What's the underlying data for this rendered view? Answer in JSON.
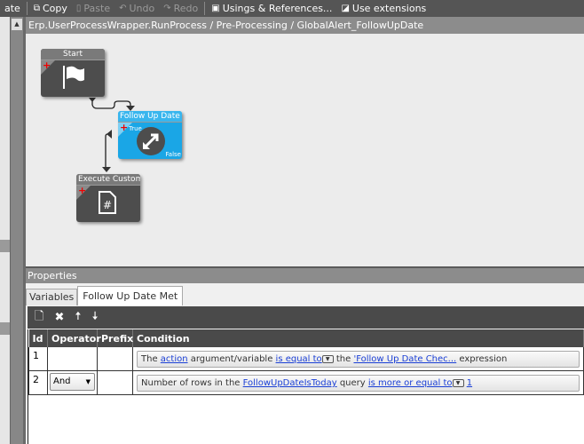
{
  "toolbar": {
    "items": [
      {
        "label": "ate",
        "enabled": true
      },
      {
        "label": "Copy",
        "icon": "copy-icon",
        "enabled": true
      },
      {
        "label": "Paste",
        "icon": "paste-icon",
        "enabled": false
      },
      {
        "label": "Undo",
        "icon": "undo-icon",
        "enabled": false
      },
      {
        "label": "Redo",
        "icon": "redo-icon",
        "enabled": false
      },
      {
        "label": "Usings & References...",
        "icon": "references-icon",
        "enabled": true
      },
      {
        "label": "Use extensions",
        "icon": "checkbox-icon",
        "enabled": true
      }
    ]
  },
  "breadcrumb": "Erp.UserProcessWrapper.RunProcess / Pre-Processing / GlobalAlert_FollowUpDate",
  "workflow": {
    "nodes": [
      {
        "title": "Start",
        "icon": "flag-icon"
      },
      {
        "title": "Follow Up Date Met",
        "visible_title": "Follow Up Date Me",
        "icon": "condition-arrows-icon",
        "true_label": "True",
        "false_label": "False",
        "accent": "#1aa6e6"
      },
      {
        "title": "Execute Custom Code",
        "visible_title": "Execute Custom Co",
        "icon": "code-file-icon"
      }
    ]
  },
  "properties": {
    "title": "Properties",
    "tabs": [
      "Variables",
      "Follow Up Date Met"
    ],
    "active_tab": "Follow Up Date Met",
    "columns": [
      "Id",
      "Operator",
      "Prefix",
      "Condition"
    ],
    "rows": [
      {
        "id": "1",
        "operator": "",
        "prefix": "",
        "cond": {
          "t1": "The ",
          "l1": "action",
          "t2": " argument/variable ",
          "l2": "is equal to",
          "t3": " the ",
          "l3": "'Follow Up Date Chec...",
          "t4": " expression"
        }
      },
      {
        "id": "2",
        "operator": "And",
        "prefix": "",
        "cond": {
          "t1": "Number of rows in the ",
          "l1": "FollowUpDateIsToday",
          "t2": " query ",
          "l2": "is more or equal to",
          "t3": " ",
          "l3": "1",
          "t4": ""
        }
      }
    ]
  }
}
